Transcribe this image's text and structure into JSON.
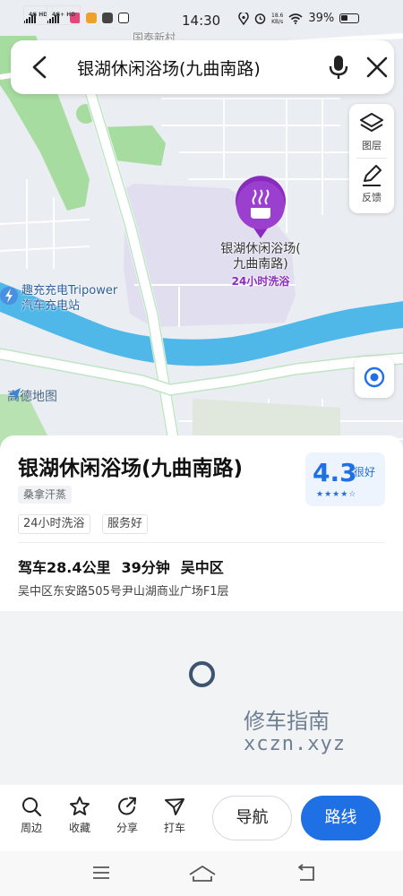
{
  "status_bar": {
    "signal1": "4G HD",
    "signal2": "4G+ HD",
    "time": "14:30",
    "net_speed_value": "18.6",
    "net_speed_unit": "KB/s",
    "battery": "39%"
  },
  "search": {
    "query": "银湖休闲浴场(九曲南路)"
  },
  "map": {
    "village_label": "国泰新村",
    "poi_name_line1": "银湖休闲浴场(",
    "poi_name_line2": "九曲南路)",
    "poi_subtitle": "24小时洗浴",
    "charging_line1": "趣充充电Tripower",
    "charging_line2": "汽车充电站",
    "brand": "高德地图"
  },
  "tools": {
    "layers_label": "图层",
    "feedback_label": "反馈"
  },
  "place": {
    "name": "银湖休闲浴场(九曲南路)",
    "category": "桑拿汗蒸",
    "tags": [
      "24小时洗浴",
      "服务好"
    ],
    "rating": "4.3",
    "rating_word": "很好",
    "stars": "★★★★☆",
    "drive_distance": "驾车28.4公里",
    "drive_time": "39分钟",
    "district": "吴中区",
    "address": "吴中区东安路505号尹山湖商业广场F1层"
  },
  "watermark": {
    "line1": "修车指南",
    "line2": "xczn.xyz"
  },
  "actions": {
    "nearby": "周边",
    "favorite": "收藏",
    "share": "分享",
    "taxi": "打车",
    "navigate": "导航",
    "route": "路线"
  },
  "colors": {
    "accent": "#1f6fe5",
    "poi_marker": "#8a2bbf",
    "river": "#4fb8e8",
    "park": "#a7dca0"
  }
}
